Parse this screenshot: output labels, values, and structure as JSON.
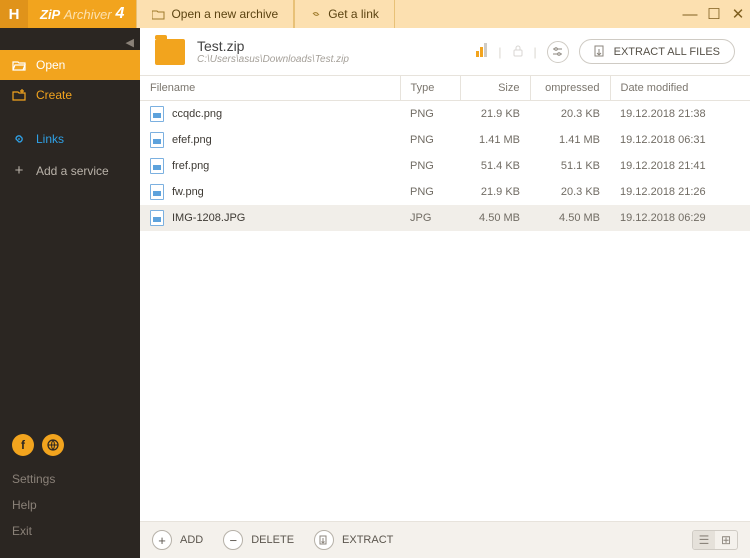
{
  "app": {
    "name_part1": "ZiP",
    "name_part2": "Archiver",
    "version": "4"
  },
  "titlebar": {
    "open_archive": "Open a new archive",
    "get_link": "Get a link"
  },
  "sidebar": {
    "open": "Open",
    "create": "Create",
    "links": "Links",
    "add_service": "Add a service",
    "settings": "Settings",
    "help": "Help",
    "exit": "Exit"
  },
  "archive": {
    "name": "Test.zip",
    "path": "C:\\Users\\asus\\Downloads\\Test.zip"
  },
  "header_actions": {
    "extract_all": "EXTRACT ALL FILES"
  },
  "columns": {
    "filename": "Filename",
    "type": "Type",
    "size": "Size",
    "compressed": "ompressed",
    "date": "Date modified"
  },
  "files": [
    {
      "name": "ccqdc.png",
      "type": "PNG",
      "size": "21.9 KB",
      "compressed": "20.3 KB",
      "date": "19.12.2018 21:38",
      "selected": false
    },
    {
      "name": "efef.png",
      "type": "PNG",
      "size": "1.41 MB",
      "compressed": "1.41 MB",
      "date": "19.12.2018 06:31",
      "selected": false
    },
    {
      "name": "fref.png",
      "type": "PNG",
      "size": "51.4 KB",
      "compressed": "51.1 KB",
      "date": "19.12.2018 21:41",
      "selected": false
    },
    {
      "name": "fw.png",
      "type": "PNG",
      "size": "21.9 KB",
      "compressed": "20.3 KB",
      "date": "19.12.2018 21:26",
      "selected": false
    },
    {
      "name": "IMG-1208.JPG",
      "type": "JPG",
      "size": "4.50 MB",
      "compressed": "4.50 MB",
      "date": "19.12.2018 06:29",
      "selected": true
    }
  ],
  "bottombar": {
    "add": "ADD",
    "delete": "DELETE",
    "extract": "EXTRACT"
  }
}
